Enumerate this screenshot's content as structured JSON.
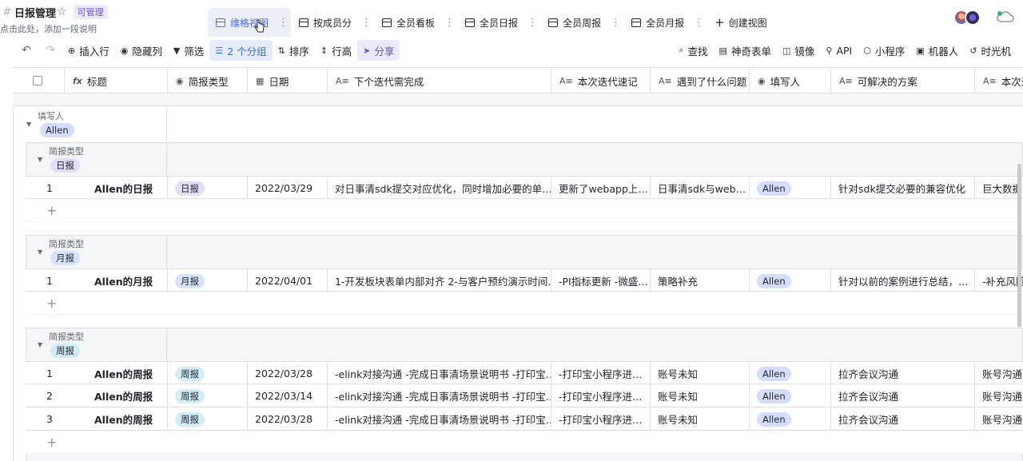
{
  "app": {
    "title": "日报管理",
    "permission_badge": "可管理",
    "description": "点击此处，添加一段说明"
  },
  "views": [
    {
      "label": "维格视图",
      "icon": "grid-icon",
      "active": true
    },
    {
      "label": "按成员分",
      "icon": "grid-icon",
      "active": false
    },
    {
      "label": "全员看板",
      "icon": "kanban-icon",
      "active": false
    },
    {
      "label": "全员日报",
      "icon": "grid-icon",
      "active": false
    },
    {
      "label": "全员周报",
      "icon": "grid-icon",
      "active": false
    },
    {
      "label": "全员月报",
      "icon": "grid-icon",
      "active": false
    }
  ],
  "add_view_label": "创建视图",
  "toolbar": {
    "insert_row": "插入行",
    "hide_columns": "隐藏列",
    "filter": "筛选",
    "group": "2 个分组",
    "sort": "排序",
    "row_height": "行高",
    "share": "分享",
    "search": "查找",
    "form": "神奇表单",
    "mirror": "镜像",
    "api": "API",
    "mini_program": "小程序",
    "robot": "机器人",
    "time_machine": "时光机"
  },
  "columns": [
    {
      "label": "标题",
      "icon": "formula-icon"
    },
    {
      "label": "简报类型",
      "icon": "single-select-icon"
    },
    {
      "label": "日期",
      "icon": "calendar-icon"
    },
    {
      "label": "下个迭代需完成",
      "icon": "text-icon"
    },
    {
      "label": "本次迭代速记",
      "icon": "text-icon"
    },
    {
      "label": "遇到了什么问题",
      "icon": "text-icon"
    },
    {
      "label": "填写人",
      "icon": "member-icon"
    },
    {
      "label": "可解决的方案",
      "icon": "text-icon"
    },
    {
      "label": "本次迭",
      "icon": "text-icon"
    }
  ],
  "group_field_outer": "填写人",
  "group_value_outer": "Allen",
  "group_field_inner": "简报类型",
  "groups": [
    {
      "value": "日报",
      "rows": [
        {
          "no": "1",
          "title": "Allen的日报",
          "type": "日报",
          "date": "2022/03/29",
          "next": "对日事清sdk提交对应优化，同时增加必要的单…",
          "notes": "更新了webapp上…",
          "problem": "日事清sdk与web…",
          "person": "Allen",
          "solution": "针对sdk提交必要的兼容优化",
          "extra": "巨大数据"
        }
      ]
    },
    {
      "value": "月报",
      "rows": [
        {
          "no": "1",
          "title": "Allen的月报",
          "type": "月报",
          "date": "2022/04/01",
          "next": "1-开发板块表单内部对齐 2-与客户预约演示时间…",
          "notes": "-PI指标更新 -微盛…",
          "problem": "策略补充",
          "person": "Allen",
          "solution": "针对以前的案例进行总结，…",
          "extra": "-补充风险"
        }
      ]
    },
    {
      "value": "周报",
      "rows": [
        {
          "no": "1",
          "title": "Allen的周报",
          "type": "周报",
          "date": "2022/03/28",
          "next": "-elink对接沟通 -完成日事清场景说明书 -打印宝…",
          "notes": "-打印宝小程序进…",
          "problem": "账号未知",
          "person": "Allen",
          "solution": "拉齐会议沟通",
          "extra": "账号沟通"
        },
        {
          "no": "2",
          "title": "Allen的周报",
          "type": "周报",
          "date": "2022/03/14",
          "next": "-elink对接沟通 -完成日事清场景说明书 -打印宝…",
          "notes": "-打印宝小程序进…",
          "problem": "账号未知",
          "person": "Allen",
          "solution": "拉齐会议沟通",
          "extra": "账号沟通"
        },
        {
          "no": "3",
          "title": "Allen的周报",
          "type": "周报",
          "date": "2022/03/28",
          "next": "-elink对接沟通 -完成日事清场景说明书 -打印宝…",
          "notes": "-打印宝小程序进…",
          "problem": "账号未知",
          "person": "Allen",
          "solution": "拉齐会议沟通",
          "extra": "账号沟通"
        }
      ]
    }
  ],
  "colors": {
    "accent": "#3370ff",
    "share": "#5b4de0",
    "tag_daily": "#e3defc",
    "tag_month": "#d8e3fb",
    "tag_week": "#d1eef8",
    "tag_person": "#d6ddfc"
  }
}
